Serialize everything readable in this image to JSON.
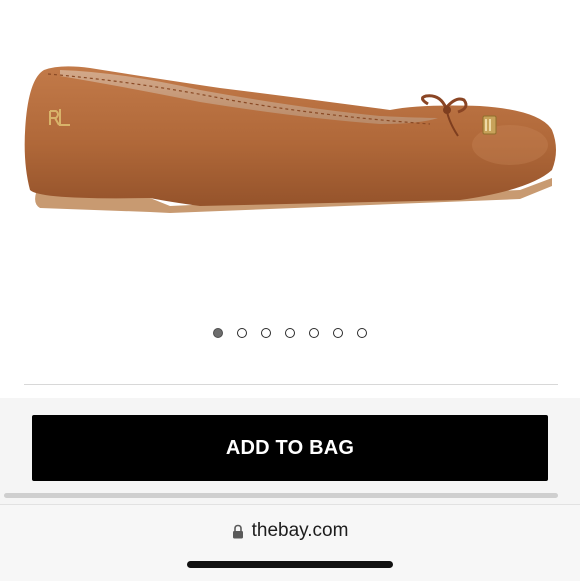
{
  "product": {
    "image_icon": "ballet-flat-shoe",
    "leather_color": "#b86e3f",
    "carousel": {
      "total": 7,
      "active_index": 0
    }
  },
  "actions": {
    "add_to_bag_label": "ADD TO BAG"
  },
  "browser": {
    "lock_icon": "lock-icon",
    "url": "thebay.com"
  }
}
